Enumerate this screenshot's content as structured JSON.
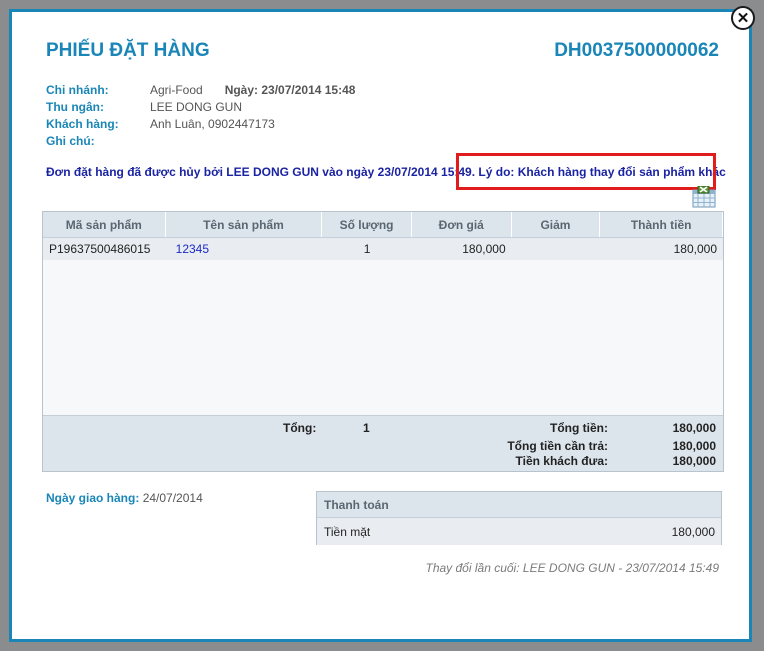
{
  "order": {
    "title": "PHIẾU ĐẶT HÀNG",
    "code": "DH0037500000062",
    "branch_label": "Chi nhánh:",
    "branch_value": "Agri-Food",
    "date_label": "Ngày: 23/07/2014 15:48",
    "cashier_label": "Thu ngân:",
    "cashier_value": "LEE DONG GUN",
    "customer_label": "Khách hàng:",
    "customer_value": "Anh Luân, 0902447173",
    "note_label": "Ghi chú:",
    "note_value": "",
    "cancel_message": "Đơn đặt hàng đã được hủy bởi LEE DONG GUN vào ngày 23/07/2014 15:49. Lý do: Khách hàng thay đổi sản phẩm khác"
  },
  "table": {
    "headers": [
      "Mã sản phẩm",
      "Tên sản phẩm",
      "Số lượng",
      "Đơn giá",
      "Giảm",
      "Thành tiền"
    ],
    "rows": [
      {
        "code": "P19637500486015",
        "name": "12345",
        "qty": "1",
        "price": "180,000",
        "discount": "",
        "amount": "180,000"
      }
    ],
    "footer": {
      "total_label": "Tổng:",
      "total_qty": "1",
      "sum_label": "Tổng tiền:",
      "sum_value": "180,000",
      "due_label": "Tổng tiền cần trả:",
      "due_value": "180,000",
      "paid_label": "Tiền khách đưa:",
      "paid_value": "180,000"
    }
  },
  "delivery": {
    "label": "Ngày giao hàng:",
    "value": "24/07/2014"
  },
  "payment": {
    "header": "Thanh toán",
    "method": "Tiền mặt",
    "amount": "180,000"
  },
  "last_change": "Thay đổi lần cuối: LEE DONG GUN - 23/07/2014 15:49",
  "icons": {
    "close": "close-icon",
    "calendar": "calendar-icon"
  },
  "colors": {
    "accent": "#1a86b8",
    "highlight": "#e11c1c",
    "message": "#1a23a3"
  }
}
